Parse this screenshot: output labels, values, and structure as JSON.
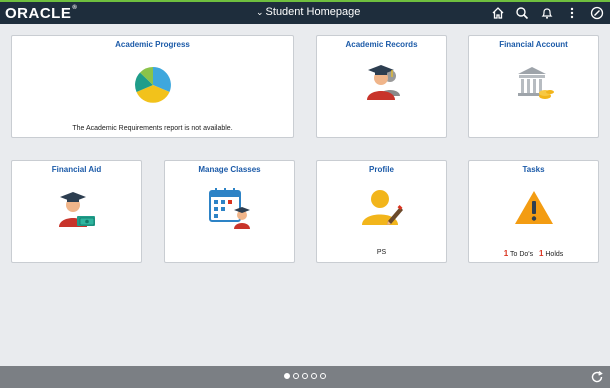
{
  "header": {
    "logo": "ORACLE",
    "logo_mark": "®",
    "page_title": "Student Homepage",
    "icons": [
      "home-icon",
      "search-icon",
      "bell-icon",
      "kebab-menu-icon",
      "compass-icon"
    ]
  },
  "tiles": {
    "academic_progress": {
      "title": "Academic Progress",
      "note": "The Academic Requirements report is not available.",
      "pie_chart": {
        "type": "pie",
        "slices": [
          {
            "color": "#3ea7dd"
          },
          {
            "color": "#f2c21b"
          },
          {
            "color": "#1f9d8a"
          },
          {
            "color": "#8bc34a"
          }
        ]
      }
    },
    "academic_records": {
      "title": "Academic Records"
    },
    "financial_account": {
      "title": "Financial Account"
    },
    "financial_aid": {
      "title": "Financial Aid"
    },
    "manage_classes": {
      "title": "Manage Classes"
    },
    "profile": {
      "title": "Profile",
      "note": "PS"
    },
    "tasks": {
      "title": "Tasks",
      "todo_count": "1",
      "todo_label": "To Do's",
      "holds_count": "1",
      "holds_label": "Holds"
    }
  },
  "footer": {
    "page_dots": 5,
    "active_dot": 0,
    "refresh_icon": "refresh-icon"
  },
  "colors": {
    "header_bg": "#1e2d3c",
    "accent_green": "#6fbf3f",
    "tile_title": "#1b5aa8",
    "footer_bg": "#7b7f84",
    "alert": "#d9331f"
  }
}
